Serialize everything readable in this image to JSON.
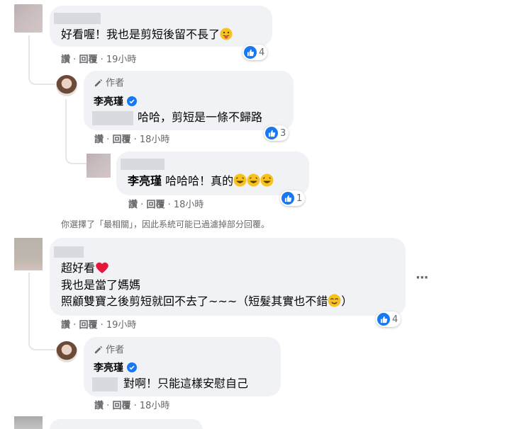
{
  "comments": [
    {
      "text": "好看喔！我也是剪短後留不長了",
      "actions": [
        "讚",
        "回覆",
        "19小時"
      ],
      "like_count": "4"
    },
    {
      "author_badge": "作者",
      "name": "李亮瑾",
      "text": "哈哈，剪短是一條不歸路",
      "actions": [
        "讚",
        "回覆",
        "18小時"
      ],
      "like_count": "3"
    },
    {
      "tag_name": "李亮瑾",
      "text": "哈哈哈！真的",
      "actions": [
        "讚",
        "回覆",
        "18小時"
      ],
      "like_count": "1"
    },
    {
      "lines": [
        "超好看",
        "我也是當了媽媽",
        "照顧雙寶之後剪短就回不去了~~~（短髮其實也不錯",
        "）"
      ],
      "actions": [
        "讚",
        "回覆",
        "19小時"
      ],
      "like_count": "4"
    },
    {
      "author_badge": "作者",
      "name": "李亮瑾",
      "text": "對啊！只能這樣安慰自己",
      "actions": [
        "讚",
        "回覆",
        "18小時"
      ]
    }
  ],
  "filter_notice": "你選擇了「最相關」，因此系統可能已過濾掉部分回覆。",
  "more_options": "···",
  "separator": "·",
  "icons": {
    "like": "thumbs-up-icon",
    "author": "pencil-icon",
    "verified": "verified-badge-icon"
  },
  "colors": {
    "like_blue": "#1877f2",
    "bubble": "#f0f2f5",
    "meta": "#65676b"
  }
}
